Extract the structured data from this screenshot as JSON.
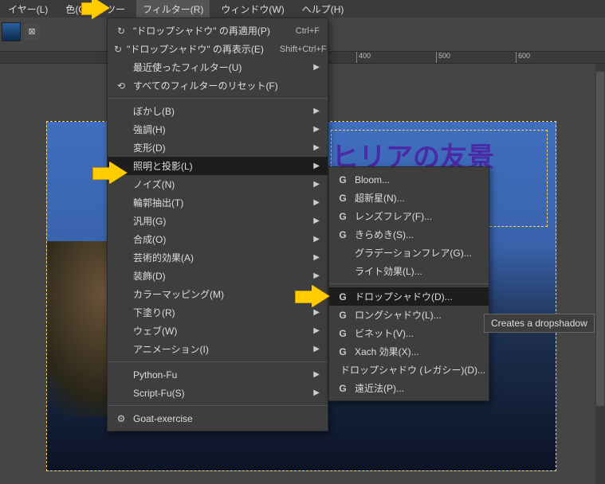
{
  "menubar": {
    "items": [
      "イヤー(L)",
      "色(C)",
      "ツー",
      "フィルター(R)",
      "ウィンドウ(W)",
      "ヘルプ(H)"
    ],
    "active_index": 3
  },
  "ruler": {
    "marks": [
      {
        "pos": 400,
        "label": "400"
      },
      {
        "pos": 500,
        "label": "500"
      },
      {
        "pos": 600,
        "label": "600"
      }
    ]
  },
  "filter_menu": {
    "groups": [
      [
        {
          "icon": "↻",
          "label": "\"ドロップシャドウ\" の再適用(P)",
          "shortcut": "Ctrl+F"
        },
        {
          "icon": "↻",
          "label": "\"ドロップシャドウ\" の再表示(E)",
          "shortcut": "Shift+Ctrl+F"
        },
        {
          "icon": "",
          "label": "最近使ったフィルター(U)",
          "submenu": true
        },
        {
          "icon": "⟲",
          "label": "すべてのフィルターのリセット(F)"
        }
      ],
      [
        {
          "label": "ぼかし(B)",
          "submenu": true
        },
        {
          "label": "強調(H)",
          "submenu": true
        },
        {
          "label": "変形(D)",
          "submenu": true
        },
        {
          "label": "照明と投影(L)",
          "submenu": true,
          "highlight": true
        },
        {
          "label": "ノイズ(N)",
          "submenu": true
        },
        {
          "label": "輪郭抽出(T)",
          "submenu": true
        },
        {
          "label": "汎用(G)",
          "submenu": true
        },
        {
          "label": "合成(O)",
          "submenu": true
        },
        {
          "label": "芸術的効果(A)",
          "submenu": true
        },
        {
          "label": "装飾(D)",
          "submenu": true
        },
        {
          "label": "カラーマッピング(M)",
          "submenu": true
        },
        {
          "label": "下塗り(R)",
          "submenu": true
        },
        {
          "label": "ウェブ(W)",
          "submenu": true
        },
        {
          "label": "アニメーション(I)",
          "submenu": true
        }
      ],
      [
        {
          "label": "Python-Fu",
          "submenu": true
        },
        {
          "label": "Script-Fu(S)",
          "submenu": true
        }
      ],
      [
        {
          "icon": "⚙",
          "label": "Goat-exercise"
        }
      ]
    ]
  },
  "light_submenu": {
    "items": [
      {
        "icon": "G",
        "label": "Bloom..."
      },
      {
        "icon": "G",
        "label": "超新星(N)..."
      },
      {
        "icon": "G",
        "label": "レンズフレア(F)..."
      },
      {
        "icon": "G",
        "label": "きらめき(S)..."
      },
      {
        "icon": "",
        "label": "グラデーションフレア(G)..."
      },
      {
        "icon": "",
        "label": "ライト効果(L)..."
      },
      {
        "sep": true
      },
      {
        "icon": "G",
        "label": "ドロップシャドウ(D)...",
        "highlight": true
      },
      {
        "icon": "G",
        "label": "ロングシャドウ(L)..."
      },
      {
        "icon": "G",
        "label": "ビネット(V)..."
      },
      {
        "icon": "G",
        "label": "Xach 効果(X)..."
      },
      {
        "icon": "",
        "label": "ドロップシャドウ (レガシー)(D)..."
      },
      {
        "icon": "G",
        "label": "遠近法(P)..."
      }
    ]
  },
  "tooltip": {
    "text": "Creates a dropshadow"
  },
  "canvas": {
    "visible_text": "ヒリアの友景"
  },
  "accent_arrow_color": "#ffcc00"
}
